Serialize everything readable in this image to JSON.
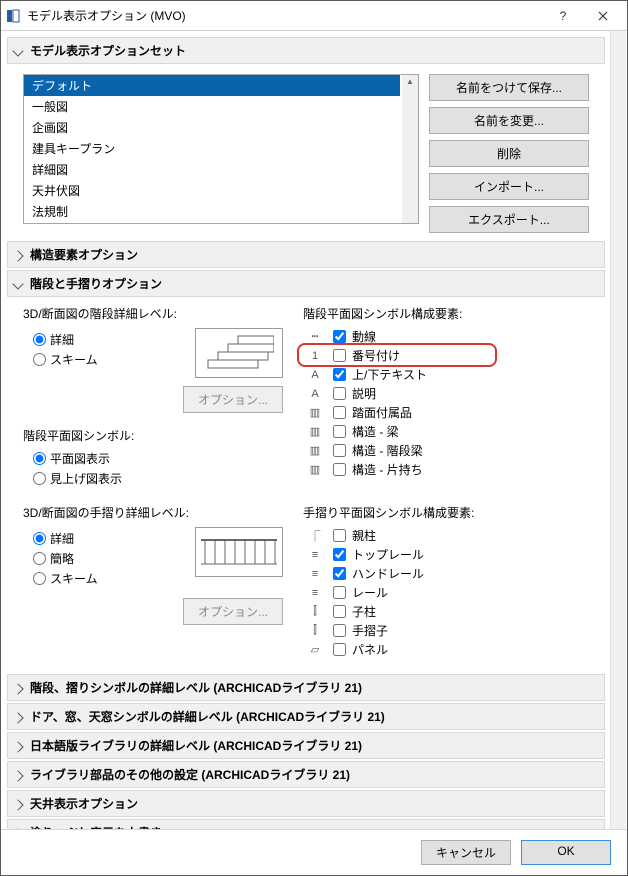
{
  "window": {
    "title": "モデル表示オプション (MVO)"
  },
  "sections": {
    "option_set": "モデル表示オプションセット",
    "structural": "構造要素オプション",
    "stair_rail": "階段と手摺りオプション",
    "stair_rail_symbol_detail": "階段、摺りシンボルの詳細レベル (ARCHICADライブラリ 21)",
    "door_window": "ドア、窓、天窓シンボルの詳細レベル (ARCHICADライブラリ 21)",
    "jp_lib": "日本語版ライブラリの詳細レベル (ARCHICADライブラリ 21)",
    "lib_other": "ライブラリ部品のその他の設定 (ARCHICADライブラリ 21)",
    "ceiling": "天井表示オプション",
    "fill": "塗りつぶし表示を上書き"
  },
  "presets": {
    "items": [
      "デフォルト",
      "一般図",
      "企画図",
      "建具キープラン",
      "詳細図",
      "天井伏図",
      "法規制"
    ],
    "selected": "デフォルト"
  },
  "buttons": {
    "save_as": "名前をつけて保存...",
    "rename": "名前を変更...",
    "delete": "削除",
    "import": "インポート...",
    "export": "エクスポート...",
    "options": "オプション...",
    "cancel": "キャンセル",
    "ok": "OK"
  },
  "stair": {
    "detail_3d_section_label": "3D/断面図の階段詳細レベル:",
    "radio_detail": "詳細",
    "radio_scheme": "スキーム",
    "plan_symbol_label": "階段平面図シンボル:",
    "radio_plan": "平面図表示",
    "radio_lookup": "見上げ図表示",
    "plan_components_label": "階段平面図シンボル構成要素:",
    "components": {
      "motion": "動線",
      "numbering": "番号付け",
      "updown": "上/下テキスト",
      "desc": "説明",
      "tread_acc": "踏面付属品",
      "struct_beam": "構造 - 梁",
      "struct_stairbeam": "構造 - 階段梁",
      "struct_cantilever": "構造 - 片持ち"
    }
  },
  "rail": {
    "detail_3d_section_label": "3D/断面図の手摺り詳細レベル:",
    "radio_detail": "詳細",
    "radio_simple": "簡略",
    "radio_scheme": "スキーム",
    "plan_components_label": "手摺り平面図シンボル構成要素:",
    "components": {
      "newel": "親柱",
      "toprail": "トップレール",
      "handrail": "ハンドレール",
      "rail": "レール",
      "baluster": "子柱",
      "handrail_sub": "手摺子",
      "panel": "パネル"
    }
  }
}
